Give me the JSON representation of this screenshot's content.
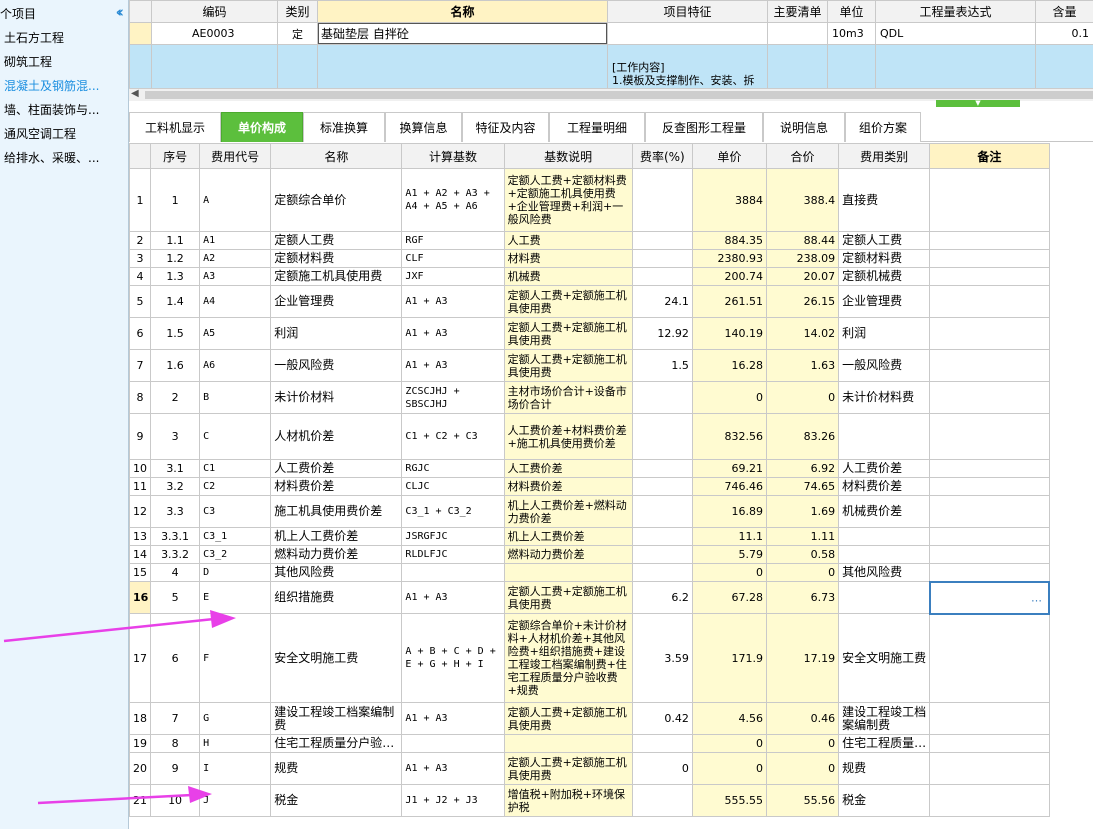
{
  "sidebar": {
    "title": "个项目",
    "collapse_icon": "double-chevron-left-icon",
    "items": [
      {
        "label": "土石方工程"
      },
      {
        "label": "砌筑工程"
      },
      {
        "label": "混凝土及钢筋混..."
      },
      {
        "label": "墙、柱面装饰与..."
      },
      {
        "label": "通风空调工程"
      },
      {
        "label": "给排水、采暖、..."
      }
    ]
  },
  "top_grid": {
    "headers": [
      "编码",
      "类别",
      "名称",
      "项目特征",
      "主要清单",
      "单位",
      "工程量表达式",
      "含量"
    ],
    "row": {
      "code": "AE0003",
      "type": "定",
      "name": "基础垫层 自拌砼",
      "unit": "10m3",
      "expr": "QDL",
      "qty": "0.1"
    },
    "work_content": "[工作内容]",
    "work_content_line": "1.模板及支撑制作、安装、拆"
  },
  "tabs": [
    "工料机显示",
    "单价构成",
    "标准换算",
    "换算信息",
    "特征及内容",
    "工程量明细",
    "反查图形工程量",
    "说明信息",
    "组价方案"
  ],
  "grid": {
    "headers": [
      "",
      "序号",
      "费用代号",
      "名称",
      "计算基数",
      "基数说明",
      "费率(%)",
      "单价",
      "合价",
      "费用类别",
      "备注"
    ],
    "rows": [
      {
        "i": "1",
        "seq": "1",
        "code": "A",
        "name": "定额综合单价",
        "base": "A1 + A2 + A3 + A4 + A5 + A6",
        "desc": "定额人工费+定额材料费+定额施工机具使用费+企业管理费+利润+一般风险费",
        "rate": "",
        "price": "3884",
        "total": "388.4",
        "cat": "直接费"
      },
      {
        "i": "2",
        "seq": "1.1",
        "code": "A1",
        "name": "定额人工费",
        "base": "RGF",
        "desc": "人工费",
        "rate": "",
        "price": "884.35",
        "total": "88.44",
        "cat": "定额人工费"
      },
      {
        "i": "3",
        "seq": "1.2",
        "code": "A2",
        "name": "定额材料费",
        "base": "CLF",
        "desc": "材料费",
        "rate": "",
        "price": "2380.93",
        "total": "238.09",
        "cat": "定额材料费"
      },
      {
        "i": "4",
        "seq": "1.3",
        "code": "A3",
        "name": "定额施工机具使用费",
        "base": "JXF",
        "desc": "机械费",
        "rate": "",
        "price": "200.74",
        "total": "20.07",
        "cat": "定额机械费"
      },
      {
        "i": "5",
        "seq": "1.4",
        "code": "A4",
        "name": "企业管理费",
        "base": "A1 + A3",
        "desc": "定额人工费+定额施工机具使用费",
        "rate": "24.1",
        "price": "261.51",
        "total": "26.15",
        "cat": "企业管理费"
      },
      {
        "i": "6",
        "seq": "1.5",
        "code": "A5",
        "name": "利润",
        "base": "A1 + A3",
        "desc": "定额人工费+定额施工机具使用费",
        "rate": "12.92",
        "price": "140.19",
        "total": "14.02",
        "cat": "利润"
      },
      {
        "i": "7",
        "seq": "1.6",
        "code": "A6",
        "name": "一般风险费",
        "base": "A1 + A3",
        "desc": "定额人工费+定额施工机具使用费",
        "rate": "1.5",
        "price": "16.28",
        "total": "1.63",
        "cat": "一般风险费"
      },
      {
        "i": "8",
        "seq": "2",
        "code": "B",
        "name": "未计价材料",
        "base": "ZCSCJHJ + SBSCJHJ",
        "desc": "主材市场价合计+设备市场价合计",
        "rate": "",
        "price": "0",
        "total": "0",
        "cat": "未计价材料费"
      },
      {
        "i": "9",
        "seq": "3",
        "code": "C",
        "name": "人材机价差",
        "base": "C1 + C2 + C3",
        "desc": "人工费价差+材料费价差+施工机具使用费价差",
        "rate": "",
        "price": "832.56",
        "total": "83.26",
        "cat": ""
      },
      {
        "i": "10",
        "seq": "3.1",
        "code": "C1",
        "name": "人工费价差",
        "base": "RGJC",
        "desc": "人工费价差",
        "rate": "",
        "price": "69.21",
        "total": "6.92",
        "cat": "人工费价差"
      },
      {
        "i": "11",
        "seq": "3.2",
        "code": "C2",
        "name": "材料费价差",
        "base": "CLJC",
        "desc": "材料费价差",
        "rate": "",
        "price": "746.46",
        "total": "74.65",
        "cat": "材料费价差"
      },
      {
        "i": "12",
        "seq": "3.3",
        "code": "C3",
        "name": "施工机具使用费价差",
        "base": "C3_1 + C3_2",
        "desc": "机上人工费价差+燃料动力费价差",
        "rate": "",
        "price": "16.89",
        "total": "1.69",
        "cat": "机械费价差"
      },
      {
        "i": "13",
        "seq": "3.3.1",
        "code": "C3_1",
        "name": "机上人工费价差",
        "base": "JSRGFJC",
        "desc": "机上人工费价差",
        "rate": "",
        "price": "11.1",
        "total": "1.11",
        "cat": ""
      },
      {
        "i": "14",
        "seq": "3.3.2",
        "code": "C3_2",
        "name": "燃料动力费价差",
        "base": "RLDLFJC",
        "desc": "燃料动力费价差",
        "rate": "",
        "price": "5.79",
        "total": "0.58",
        "cat": ""
      },
      {
        "i": "15",
        "seq": "4",
        "code": "D",
        "name": "其他风险费",
        "base": "",
        "desc": "",
        "rate": "",
        "price": "0",
        "total": "0",
        "cat": "其他风险费"
      },
      {
        "i": "16",
        "seq": "5",
        "code": "E",
        "name": "组织措施费",
        "base": "A1 + A3",
        "desc": "定额人工费+定额施工机具使用费",
        "rate": "6.2",
        "price": "67.28",
        "total": "6.73",
        "cat": ""
      },
      {
        "i": "17",
        "seq": "6",
        "code": "F",
        "name": "安全文明施工费",
        "base": "A + B + C + D + E + G + H + I",
        "desc": "定额综合单价+未计价材料+人材机价差+其他风险费+组织措施费+建设工程竣工档案编制费+住宅工程质量分户验收费+规费",
        "rate": "3.59",
        "price": "171.9",
        "total": "17.19",
        "cat": "安全文明施工费"
      },
      {
        "i": "18",
        "seq": "7",
        "code": "G",
        "name": "建设工程竣工档案编制费",
        "base": "A1 + A3",
        "desc": "定额人工费+定额施工机具使用费",
        "rate": "0.42",
        "price": "4.56",
        "total": "0.46",
        "cat": "建设工程竣工档案编制费"
      },
      {
        "i": "19",
        "seq": "8",
        "code": "H",
        "name": "住宅工程质量分户验…",
        "base": "",
        "desc": "",
        "rate": "",
        "price": "0",
        "total": "0",
        "cat": "住宅工程质量…"
      },
      {
        "i": "20",
        "seq": "9",
        "code": "I",
        "name": "规费",
        "base": "A1 + A3",
        "desc": "定额人工费+定额施工机具使用费",
        "rate": "0",
        "price": "0",
        "total": "0",
        "cat": "规费"
      },
      {
        "i": "21",
        "seq": "10",
        "code": "J",
        "name": "税金",
        "base": "J1 + J2 + J3",
        "desc": "增值税+附加税+环境保护税",
        "rate": "",
        "price": "555.55",
        "total": "55.56",
        "cat": "税金"
      }
    ],
    "selected_remark_button": "…"
  },
  "colors": {
    "accent_green": "#5cbf3d",
    "highlight_yellow": "#fff3c4",
    "annotation_arrow": "#e840e8"
  }
}
